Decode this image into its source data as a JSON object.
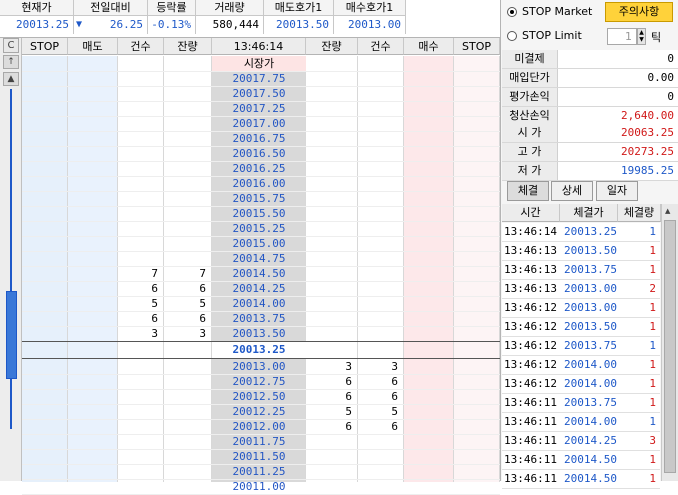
{
  "quote": {
    "headers": [
      "현재가",
      "전일대비",
      "등락률",
      "거래량",
      "매도호가1",
      "매수호가1"
    ],
    "current_price": "20013.25",
    "change_symbol": "▼",
    "change": "26.25",
    "change_rate": "-0.13%",
    "volume": "580,444",
    "ask1": "20013.50",
    "bid1": "20013.00"
  },
  "gutter": {
    "top_label": "C",
    "arrow_up": "↑",
    "triangle_up": "▲"
  },
  "table": {
    "headers": [
      "STOP",
      "매도",
      "건수",
      "잔량",
      "13:46:14",
      "잔량",
      "건수",
      "매수",
      "STOP"
    ],
    "open_label": "시장가",
    "center_price": "20013.25",
    "sell_prices": [
      "20017.75",
      "20017.50",
      "20017.25",
      "20017.00",
      "20016.75",
      "20016.50",
      "20016.25",
      "20016.00",
      "20015.75",
      "20015.50",
      "20015.25",
      "20015.00",
      "20014.75",
      "20014.50",
      "20014.25",
      "20014.00",
      "20013.75",
      "20013.50"
    ],
    "sell_counts": [
      "",
      "",
      "",
      "",
      "",
      "",
      "",
      "",
      "",
      "",
      "",
      "",
      "",
      "7",
      "6",
      "5",
      "6",
      "3"
    ],
    "sell_qtys": [
      "",
      "",
      "",
      "",
      "",
      "",
      "",
      "",
      "",
      "",
      "",
      "",
      "",
      "7",
      "6",
      "5",
      "6",
      "3"
    ],
    "buy_prices": [
      "20013.00",
      "20012.75",
      "20012.50",
      "20012.25",
      "20012.00",
      "20011.75",
      "20011.50",
      "20011.25",
      "20011.00"
    ],
    "buy_qtys": [
      "3",
      "6",
      "6",
      "5",
      "6",
      "",
      "",
      "",
      ""
    ],
    "buy_counts": [
      "3",
      "6",
      "6",
      "5",
      "6",
      "",
      "",
      "",
      ""
    ]
  },
  "right": {
    "stop_market": "STOP Market",
    "stop_limit": "STOP Limit",
    "warning_btn": "주의사항",
    "tick_value": "1",
    "tick_label": "틱",
    "summary": [
      {
        "k": "미결제",
        "v": "0"
      },
      {
        "k": "매입단가",
        "v": "0.00"
      },
      {
        "k": "평가손익",
        "v": "0"
      },
      {
        "k": "청산손익",
        "v": "2,640.00"
      }
    ],
    "ohlc": [
      {
        "k": "시 가",
        "v": "20063.25"
      },
      {
        "k": "고 가",
        "v": "20273.25"
      },
      {
        "k": "저 가",
        "v": "19985.25"
      }
    ],
    "tabs": [
      "체결",
      "상세",
      "일자"
    ],
    "trade_headers": [
      "시간",
      "체결가",
      "체결량"
    ],
    "trades": [
      {
        "t": "13:46:14",
        "p": "20013.25",
        "q": "1",
        "side": "b"
      },
      {
        "t": "13:46:13",
        "p": "20013.50",
        "q": "1",
        "side": "r"
      },
      {
        "t": "13:46:13",
        "p": "20013.75",
        "q": "1",
        "side": "r"
      },
      {
        "t": "13:46:13",
        "p": "20013.00",
        "q": "2",
        "side": "r"
      },
      {
        "t": "13:46:12",
        "p": "20013.00",
        "q": "1",
        "side": "r"
      },
      {
        "t": "13:46:12",
        "p": "20013.50",
        "q": "1",
        "side": "r"
      },
      {
        "t": "13:46:12",
        "p": "20013.75",
        "q": "1",
        "side": "b"
      },
      {
        "t": "13:46:12",
        "p": "20014.00",
        "q": "1",
        "side": "r"
      },
      {
        "t": "13:46:12",
        "p": "20014.00",
        "q": "1",
        "side": "r"
      },
      {
        "t": "13:46:11",
        "p": "20013.75",
        "q": "1",
        "side": "r"
      },
      {
        "t": "13:46:11",
        "p": "20014.00",
        "q": "1",
        "side": "b"
      },
      {
        "t": "13:46:11",
        "p": "20014.25",
        "q": "3",
        "side": "r"
      },
      {
        "t": "13:46:11",
        "p": "20014.50",
        "q": "1",
        "side": "r"
      },
      {
        "t": "13:46:11",
        "p": "20014.50",
        "q": "1",
        "side": "r"
      }
    ]
  }
}
